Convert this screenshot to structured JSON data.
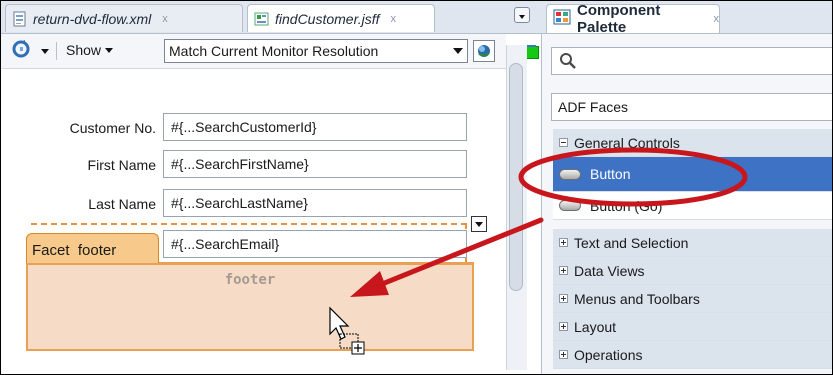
{
  "editor_tabs": [
    {
      "label": "return-dvd-flow.xml",
      "close": "x"
    },
    {
      "label": "findCustomer.jsff",
      "close": "x"
    }
  ],
  "toolbar": {
    "show_label": "Show",
    "resolution_value": "Match Current Monitor Resolution"
  },
  "form": {
    "rows": [
      {
        "label": "Customer No.",
        "value": "#{...SearchCustomerId}"
      },
      {
        "label": "First Name",
        "value": "#{...SearchFirstName}"
      },
      {
        "label": "Last Name",
        "value": "#{...SearchLastName}"
      }
    ],
    "email_value": "#{...SearchEmail}",
    "facet_label": "Facet  footer",
    "footer_placeholder": "footer"
  },
  "palette": {
    "title": "Component Palette",
    "close": "x",
    "library": "ADF Faces",
    "items": [
      {
        "label": "General Controls",
        "kind": "group-open"
      },
      {
        "label": "Button",
        "kind": "item-selected"
      },
      {
        "label": "Button (Go)",
        "kind": "item"
      },
      {
        "label": "Text and Selection",
        "kind": "group"
      },
      {
        "label": "Data Views",
        "kind": "group"
      },
      {
        "label": "Menus and Toolbars",
        "kind": "group"
      },
      {
        "label": "Layout",
        "kind": "group"
      },
      {
        "label": "Operations",
        "kind": "group"
      }
    ]
  },
  "colors": {
    "selection_blue": "#3d72c4",
    "annotation_red": "#c8171c",
    "facet_orange": "#f7c98a",
    "drop_zone": "#f6dcc6"
  },
  "icons": [
    "xml-file-icon",
    "jsff-file-icon",
    "refresh-icon",
    "monitor-icon",
    "search-icon",
    "palette-icon",
    "button-icon",
    "drag-cursor-icon"
  ]
}
